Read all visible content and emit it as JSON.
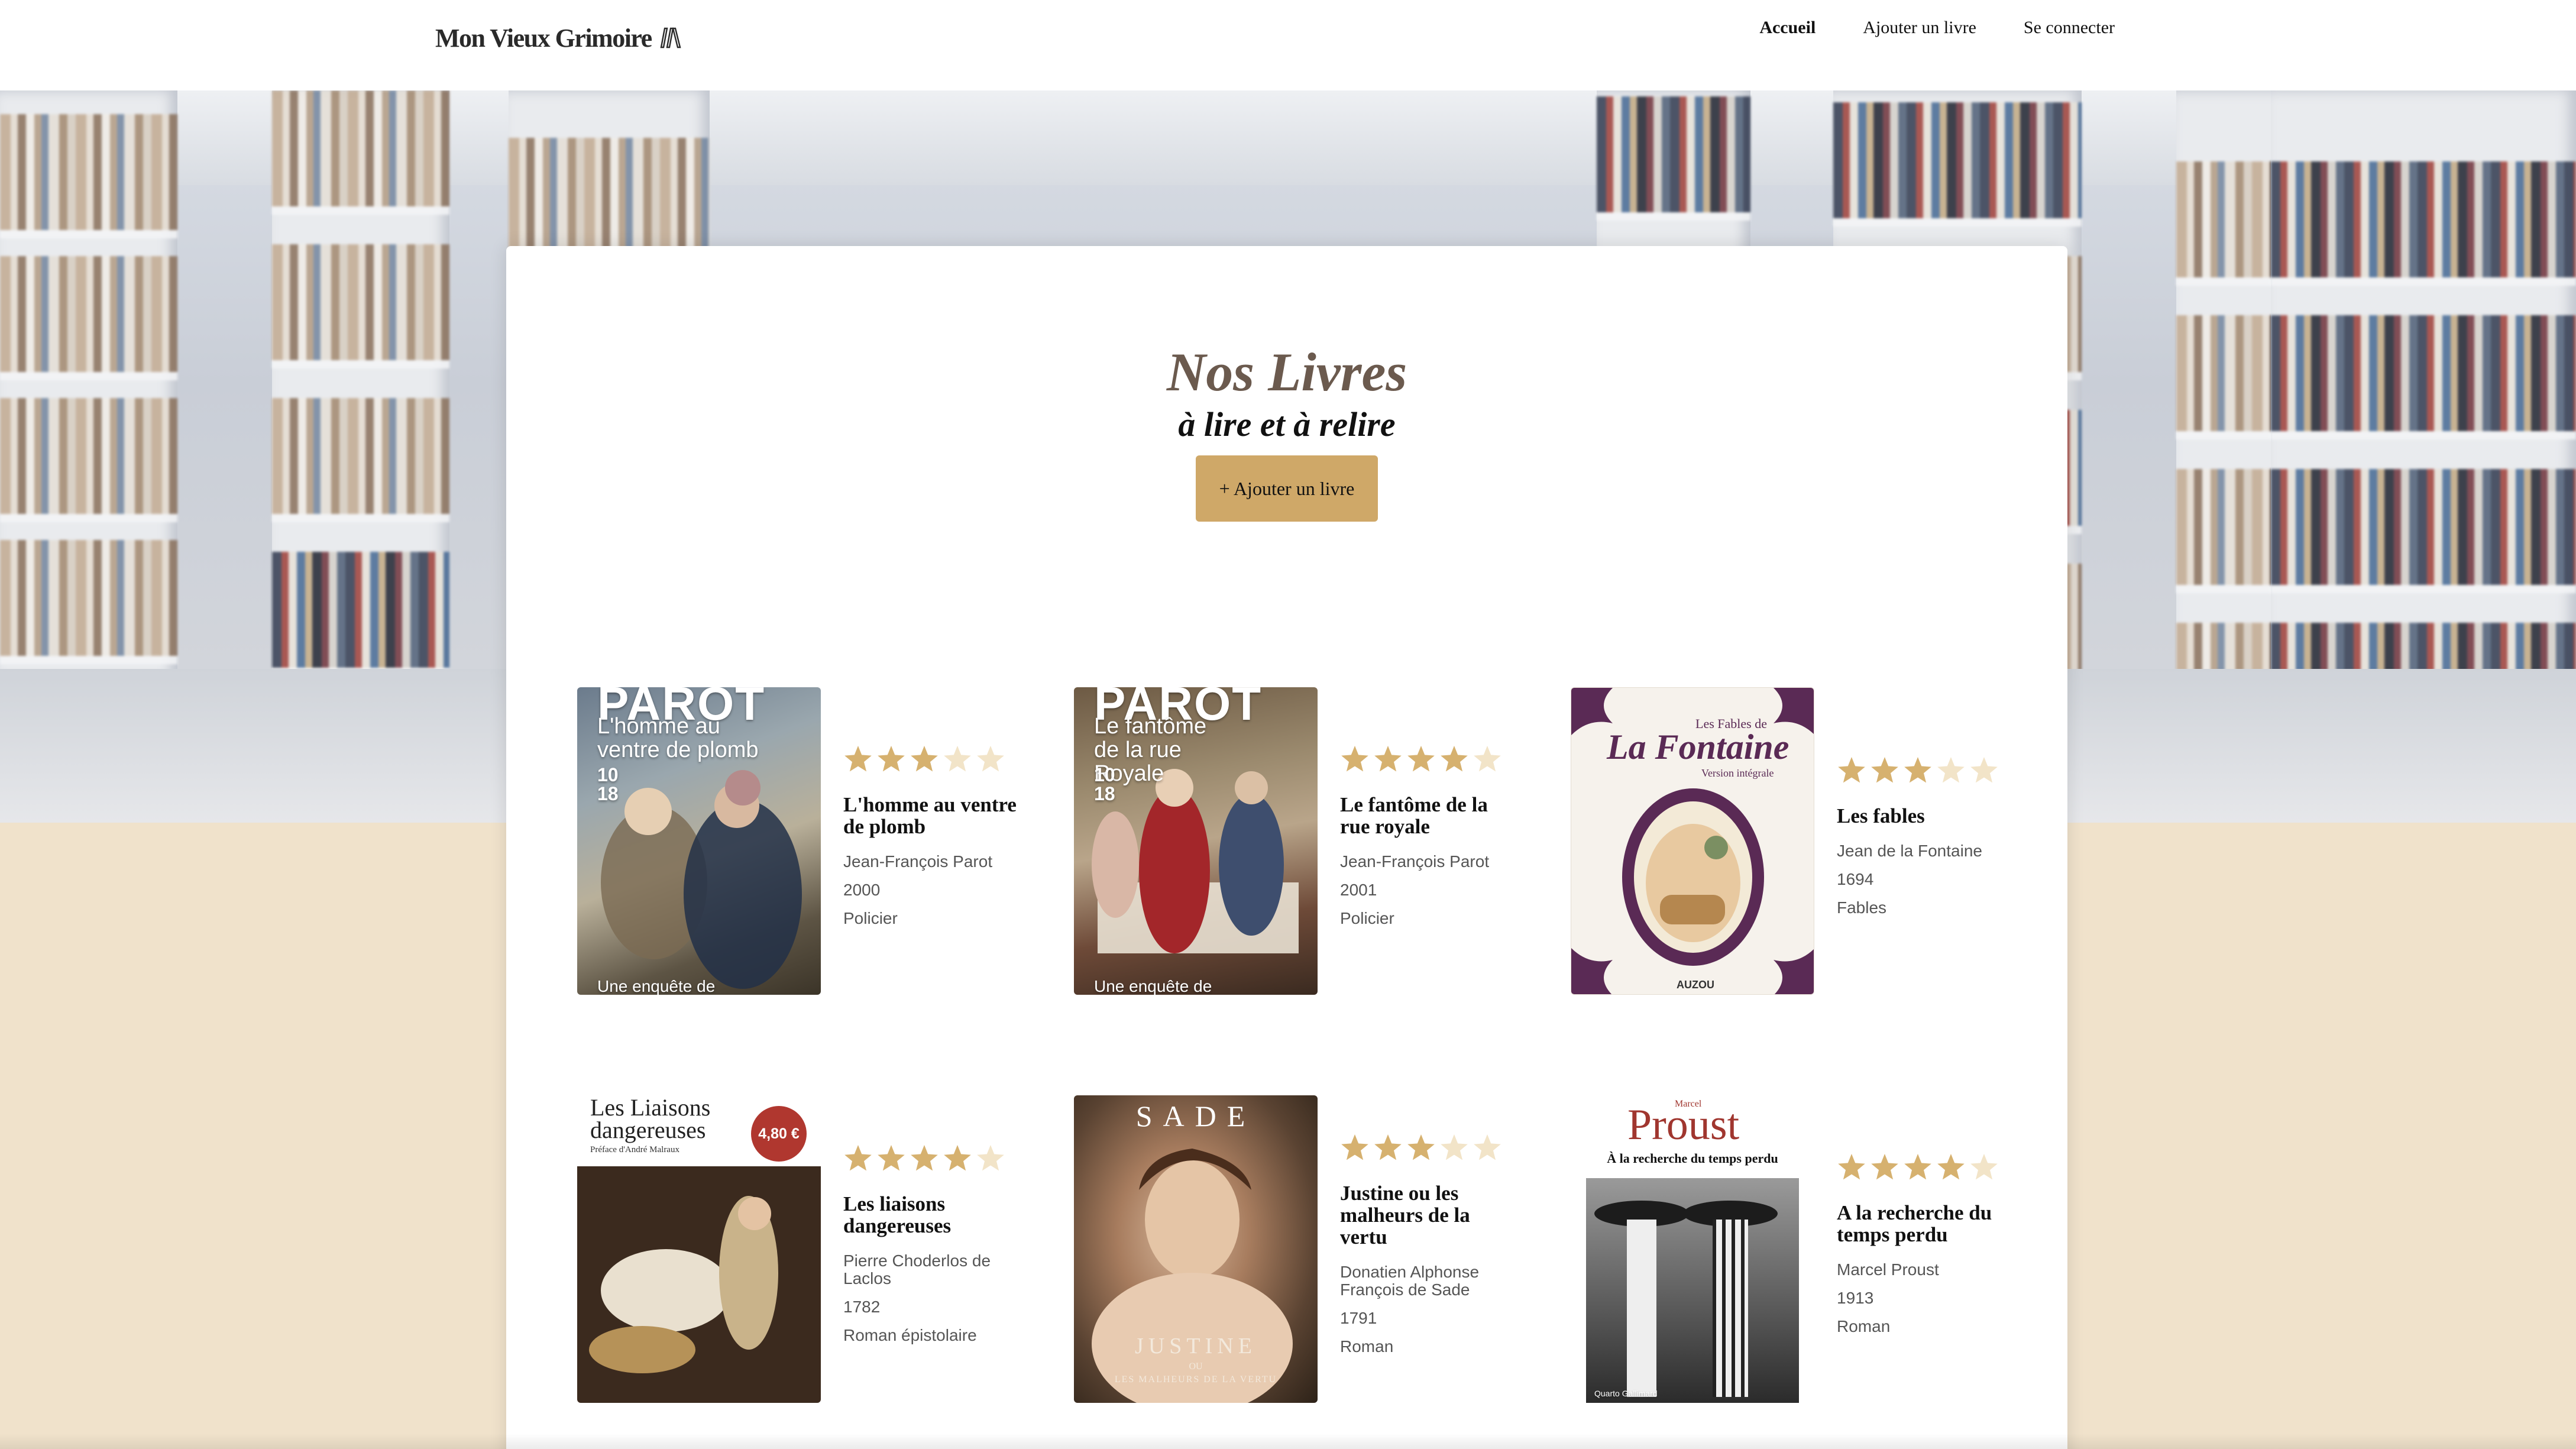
{
  "header": {
    "logo_text": "Mon Vieux Grimoire",
    "nav": {
      "home": "Accueil",
      "add_book": "Ajouter un livre",
      "login": "Se connecter"
    }
  },
  "main": {
    "title": "Nos Livres",
    "subtitle": "à lire et à relire",
    "add_button": "+ Ajouter un livre"
  },
  "books": [
    {
      "title": "L'homme au ventre de plomb",
      "author": "Jean-François Parot",
      "year": "2000",
      "genre": "Policier",
      "rating": 3,
      "cover": {
        "brand": "PAROT",
        "title": "L'homme au ventre de plomb",
        "series": "10 18",
        "footer": "Une enquête de"
      }
    },
    {
      "title": "Le fantôme de la rue royale",
      "author": "Jean-François Parot",
      "year": "2001",
      "genre": "Policier",
      "rating": 4,
      "cover": {
        "brand": "PAROT",
        "title": "Le fantôme de la rue Royale",
        "series": "10 18",
        "footer": "Une enquête de"
      }
    },
    {
      "title": "Les fables",
      "author": "Jean de la Fontaine",
      "year": "1694",
      "genre": "Fables",
      "rating": 3,
      "cover": {
        "top": "Les Fables de",
        "brand": "La Fontaine",
        "sub": "Version intégrale",
        "footer": "AUZOU"
      }
    },
    {
      "title": "Les liaisons dangereuses",
      "author": "Pierre Choderlos de Laclos",
      "year": "1782",
      "genre": "Roman épistolaire",
      "rating": 4,
      "cover": {
        "title": "Les Liaisons dangereuses",
        "sub": "Préface d'André Malraux",
        "price": "4,80 €"
      }
    },
    {
      "title": "Justine ou les malheurs de la vertu",
      "author": "Donatien Alphonse François de Sade",
      "year": "1791",
      "genre": "Roman",
      "rating": 3,
      "cover": {
        "brand": "SADE",
        "title": "JUSTINE",
        "sub": "OU",
        "footer": "LES MALHEURS DE LA VERTU"
      }
    },
    {
      "title": "A la recherche du temps perdu",
      "author": "Marcel Proust",
      "year": "1913",
      "genre": "Roman",
      "rating": 4,
      "cover": {
        "top": "Marcel",
        "brand": "Proust",
        "title": "À la recherche du temps perdu",
        "footer": "Quarto Gallimard"
      }
    }
  ],
  "colors": {
    "accent": "#cfa868",
    "star_filled": "#d6b16f",
    "star_empty": "#f2e4c8",
    "page_bg": "#f0e2cb",
    "title": "#6b5a4e"
  }
}
